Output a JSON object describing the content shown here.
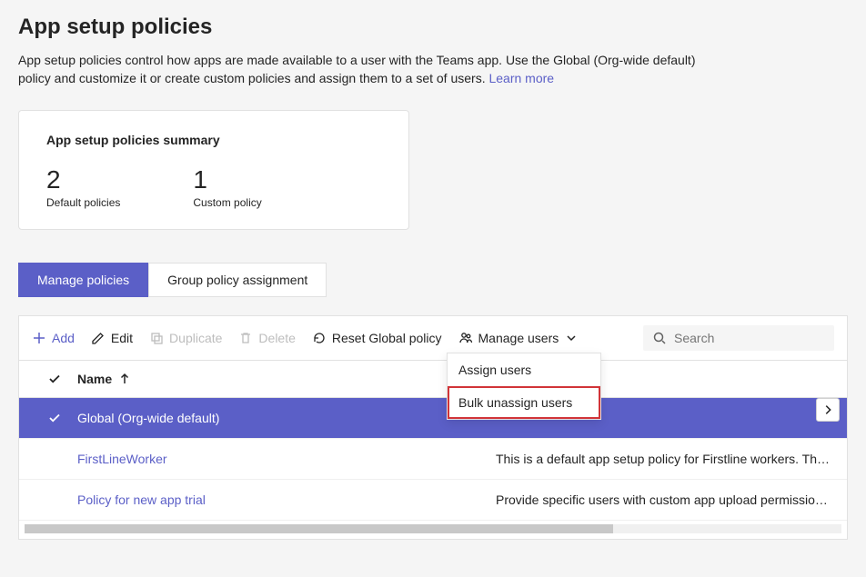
{
  "header": {
    "title": "App setup policies",
    "description_a": "App setup policies control how apps are made available to a user with the Teams app. Use the Global (Org-wide default) policy and customize it or create custom policies and assign them to a set of users. ",
    "learn_more": "Learn more"
  },
  "summary": {
    "title": "App setup policies summary",
    "default_count": "2",
    "default_label": "Default policies",
    "custom_count": "1",
    "custom_label": "Custom policy"
  },
  "tabs": {
    "manage": "Manage policies",
    "group_assign": "Group policy assignment"
  },
  "toolbar": {
    "add": "Add",
    "edit": "Edit",
    "duplicate": "Duplicate",
    "delete": "Delete",
    "reset": "Reset Global policy",
    "manage_users": "Manage users",
    "search_placeholder": "Search"
  },
  "manage_users_menu": {
    "assign": "Assign users",
    "bulk_unassign": "Bulk unassign users"
  },
  "table": {
    "col_name": "Name",
    "rows": [
      {
        "name": "Global (Org-wide default)",
        "desc": "",
        "selected": true,
        "link": false
      },
      {
        "name": "FirstLineWorker",
        "desc": "This is a default app setup policy for Firstline workers. Th…",
        "selected": false,
        "link": true
      },
      {
        "name": "Policy for new app trial",
        "desc": "Provide specific users with custom app upload permissio…",
        "selected": false,
        "link": true
      }
    ]
  }
}
